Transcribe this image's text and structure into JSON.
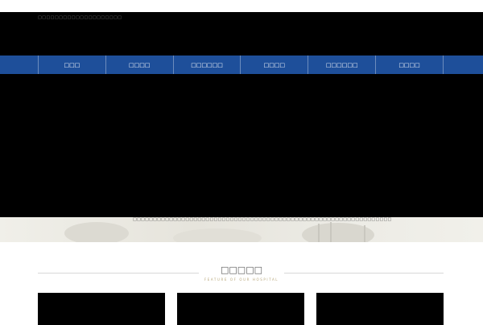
{
  "header": {
    "tagline": "□□□□□□□□□□□□□□□□□□□□"
  },
  "nav": {
    "items": [
      {
        "label": "□□□"
      },
      {
        "label": "□□□□"
      },
      {
        "label": "□□□□□□"
      },
      {
        "label": "□□□□"
      },
      {
        "label": "□□□□□□"
      },
      {
        "label": "□□□□"
      }
    ]
  },
  "banner": {
    "caption": "□□□□□□□□□□□□□□□□□□□□□□□□□□□□□□□□□□□□□□□□□□□□□□□□□□□□□□□□□□□□□□□□"
  },
  "section": {
    "title": "□□□□□",
    "subtitle": "FEATURE OF OUR HOSPITAL"
  },
  "colors": {
    "nav_bg": "#1e4f9a",
    "subtitle": "#b8a77a"
  }
}
